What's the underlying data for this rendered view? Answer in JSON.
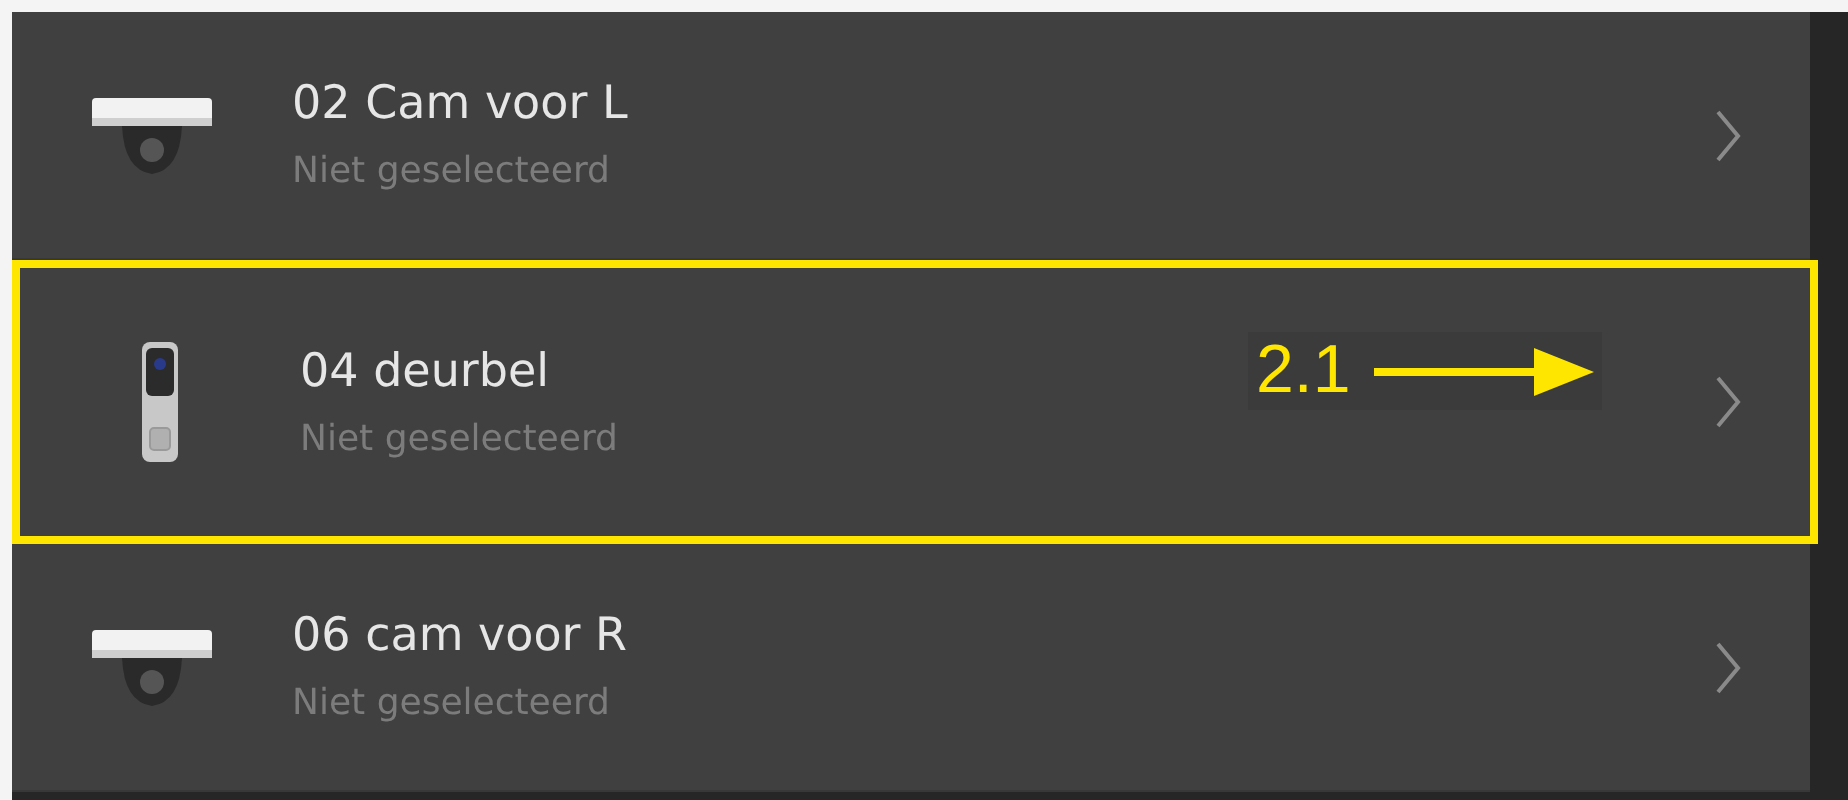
{
  "devices": [
    {
      "kind": "dome",
      "name": "02 Cam voor L",
      "status": "Niet geselecteerd",
      "highlighted": false
    },
    {
      "kind": "doorbell",
      "name": "04 deurbel",
      "status": "Niet geselecteerd",
      "highlighted": true
    },
    {
      "kind": "dome",
      "name": "06 cam voor R",
      "status": "Niet geselecteerd",
      "highlighted": false
    }
  ],
  "annotation": {
    "label": "2.1"
  }
}
